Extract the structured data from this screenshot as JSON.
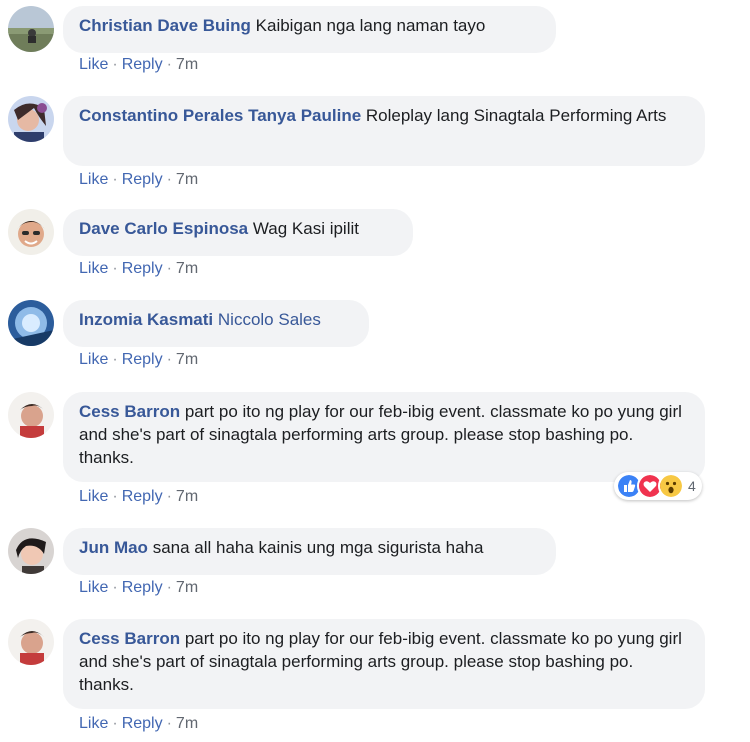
{
  "actions": {
    "like": "Like",
    "reply": "Reply",
    "separator": "·"
  },
  "comments": [
    {
      "author": "Christian Dave Buing",
      "text": "Kaibigan nga lang naman tayo",
      "tag": "",
      "time": "7m"
    },
    {
      "author": "Constantino Perales Tanya Pauline",
      "text": "Roleplay lang Sinagtala Performing Arts",
      "tag": "",
      "time": "7m"
    },
    {
      "author": "Dave Carlo Espinosa",
      "text": "Wag Kasi ipilit",
      "tag": "",
      "time": "7m"
    },
    {
      "author": "Inzomia Kasmati",
      "text": "",
      "tag": "Niccolo Sales",
      "time": "7m"
    },
    {
      "author": "Cess Barron",
      "text": "part po ito ng play for our feb-ibig event. classmate ko po yung girl and she's part of sinagtala performing arts group. please stop bashing po. thanks.",
      "tag": "",
      "time": "7m",
      "reactions": {
        "icons": [
          "like-reaction-icon",
          "love-reaction-icon",
          "wow-reaction-icon"
        ],
        "count": "4"
      }
    },
    {
      "author": "Jun Mao",
      "text": "sana all haha kainis ung mga sigurista haha",
      "tag": "",
      "time": "7m"
    },
    {
      "author": "Cess Barron",
      "text": "part po ito ng play for our feb-ibig event. classmate ko po yung girl and she's part of sinagtala performing arts group. please stop bashing po. thanks.",
      "tag": "",
      "time": "7m"
    }
  ],
  "colors": {
    "author": "#385898",
    "link": "#4267b2",
    "bubble": "#f2f3f5",
    "meta": "#606770"
  }
}
